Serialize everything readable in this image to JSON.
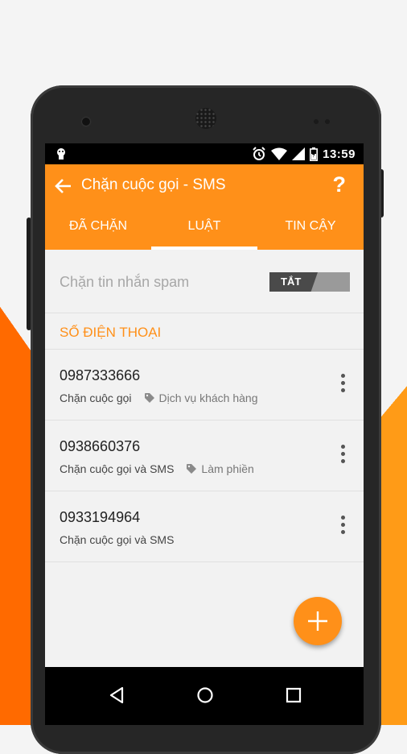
{
  "status_bar": {
    "time": "13:59"
  },
  "app_bar": {
    "title": "Chặn cuộc gọi - SMS",
    "help_label": "?"
  },
  "tabs": [
    {
      "label": "ĐÃ CHẶN",
      "active": false
    },
    {
      "label": "LUẬT",
      "active": true
    },
    {
      "label": "TIN CẬY",
      "active": false
    }
  ],
  "spam_rule": {
    "label": "Chặn tin nhắn spam",
    "toggle_label": "TẮT"
  },
  "section": {
    "title": "SỐ ĐIỆN THOẠI"
  },
  "numbers": [
    {
      "number": "0987333666",
      "action": "Chặn cuộc gọi",
      "tag": "Dịch vụ khách hàng"
    },
    {
      "number": "0938660376",
      "action": "Chặn cuộc gọi và SMS",
      "tag": "Làm phiền"
    },
    {
      "number": "0933194964",
      "action": "Chặn cuộc gọi và SMS",
      "tag": ""
    }
  ],
  "colors": {
    "accent": "#ff9019",
    "background": "#f2f2f2"
  },
  "icons": {
    "back": "arrow-left-icon",
    "more": "more-vertical-icon",
    "tag": "tag-icon",
    "fab": "plus-icon"
  }
}
